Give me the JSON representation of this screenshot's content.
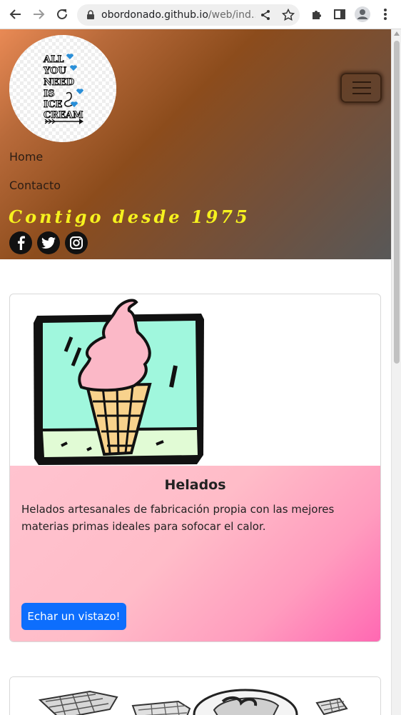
{
  "browser": {
    "url_host": "obordonado.github.io",
    "url_path": "/web/ind...",
    "icons": [
      "back-arrow-icon",
      "forward-arrow-icon",
      "reload-icon",
      "lock-icon",
      "share-icon",
      "star-icon",
      "extensions-icon",
      "side-panel-icon",
      "profile-icon",
      "menu-kebab-icon"
    ]
  },
  "header": {
    "logo_text": [
      "ALL",
      "YOU",
      "NEED",
      "IS",
      "ICE",
      "CREAM"
    ],
    "nav": [
      "Home",
      "Contacto"
    ],
    "tagline": "Contigo desde 1975",
    "social": [
      "facebook-icon",
      "twitter-icon",
      "instagram-icon"
    ],
    "colors": {
      "tagline": "#f6f21e"
    }
  },
  "cards": [
    {
      "title": "Helados",
      "text": "Helados artesanales de fabricación propia con las mejores materias primas ideales para sofocar el calor.",
      "button": "Echar un vistazo!",
      "image": "ice-cream-cone-illustration"
    }
  ],
  "colors": {
    "button": "#0d6efd"
  }
}
